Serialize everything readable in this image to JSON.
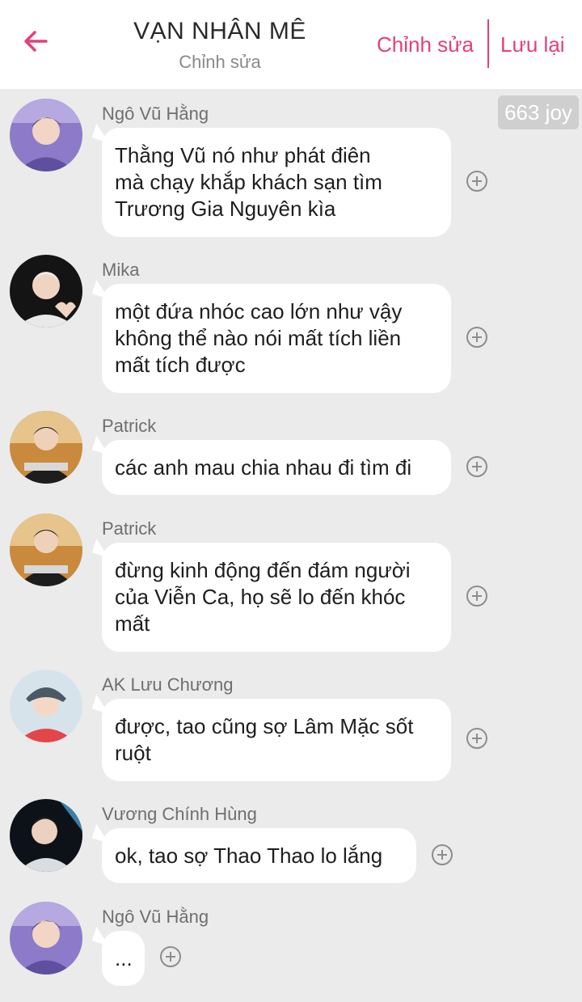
{
  "header": {
    "title": "VẠN NHÂN MÊ",
    "subtitle": "Chỉnh sửa",
    "edit_label": "Chỉnh sửa",
    "save_label": "Lưu lại",
    "accent_color": "#e0407e"
  },
  "badge": "663 joy",
  "messages": [
    {
      "name": "Ngô Vũ Hằng",
      "lines": [
        "Thằng Vũ nó như phát điên",
        "mà chạy khắp khách sạn tìm",
        "Trương Gia Nguyên kìa"
      ]
    },
    {
      "name": "Mika",
      "lines": [
        "một đứa nhóc cao lớn như vậy",
        "không thể nào nói mất tích liền",
        "mất tích được"
      ]
    },
    {
      "name": "Patrick",
      "lines": [
        "các anh mau chia nhau đi tìm đi"
      ]
    },
    {
      "name": "Patrick",
      "lines": [
        "đừng kinh động đến đám người",
        "của Viễn Ca, họ sẽ lo đến khóc",
        "mất"
      ]
    },
    {
      "name": "AK Lưu Chương",
      "lines": [
        "được, tao cũng sợ Lâm Mặc sốt",
        "ruột"
      ]
    },
    {
      "name": "Vương Chính Hùng",
      "lines": [
        "ok, tao sợ Thao Thao lo lắng"
      ]
    },
    {
      "name": "Ngô Vũ Hằng",
      "lines": [
        "..."
      ]
    }
  ],
  "icons": {
    "back": "arrow-left-icon",
    "add": "plus-circle-icon"
  }
}
